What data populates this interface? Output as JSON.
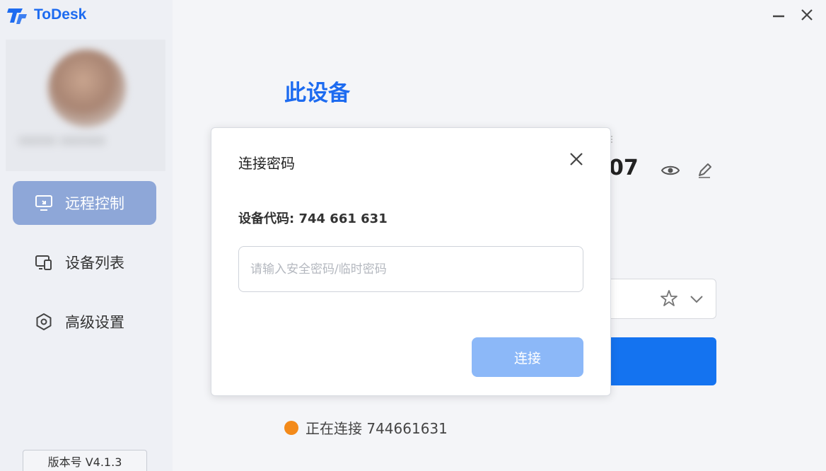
{
  "app": {
    "name": "ToDesk",
    "brand_color": "#1d6bf0"
  },
  "sidebar": {
    "profile": {
      "username": "xxxxx xxxxxx"
    },
    "items": [
      {
        "label": "远程控制",
        "icon": "monitor-icon",
        "active": true
      },
      {
        "label": "设备列表",
        "icon": "devices-icon",
        "active": false
      },
      {
        "label": "高级设置",
        "icon": "settings-icon",
        "active": false
      }
    ],
    "version": "版本号 V4.1.3"
  },
  "main": {
    "section_title": "此设备",
    "device_code_partial": "07",
    "status": {
      "text": "正在连接 744661631",
      "dot_color": "#f38a1a"
    },
    "connect_button_color": "#1473f0"
  },
  "dialog": {
    "title": "连接密码",
    "device_code": "设备代码: 744 661 631",
    "password_placeholder": "请输入安全密码/临时密码",
    "password_value": "",
    "connect_label": "连接",
    "connect_color": "#8cb8f8"
  }
}
